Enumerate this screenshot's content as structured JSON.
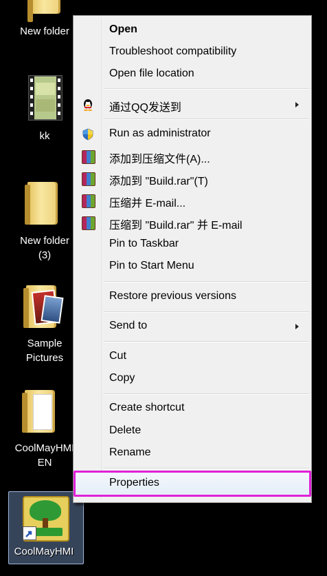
{
  "desktop": {
    "icons": [
      {
        "label": "New folder",
        "icon": "folder-icon"
      },
      {
        "label": "kk",
        "icon": "video-file-icon"
      },
      {
        "label": "New folder\n(3)",
        "icon": "folder-icon"
      },
      {
        "label": "Sample\nPictures",
        "icon": "pictures-folder-icon"
      },
      {
        "label": "CoolMayHMI\nEN",
        "icon": "folder-icon"
      },
      {
        "label": "CoolMayHMI",
        "icon": "app-shortcut-icon"
      }
    ]
  },
  "context_menu": {
    "items": [
      {
        "label": "Open"
      },
      {
        "label": "Troubleshoot compatibility"
      },
      {
        "label": "Open file location"
      },
      {
        "label": "通过QQ发送到",
        "icon": "qq-penguin-icon"
      },
      {
        "label": "Run as administrator",
        "icon": "uac-shield-icon"
      },
      {
        "label": "添加到压缩文件(A)...",
        "icon": "winrar-icon"
      },
      {
        "label": "添加到 \"Build.rar\"(T)",
        "icon": "winrar-icon"
      },
      {
        "label": "压缩并 E-mail...",
        "icon": "winrar-icon"
      },
      {
        "label": "压缩到 \"Build.rar\" 并 E-mail",
        "icon": "winrar-icon"
      },
      {
        "label": "Pin to Taskbar"
      },
      {
        "label": "Pin to Start Menu"
      },
      {
        "label": "Restore previous versions"
      },
      {
        "label": "Send to"
      },
      {
        "label": "Cut"
      },
      {
        "label": "Copy"
      },
      {
        "label": "Create shortcut"
      },
      {
        "label": "Delete"
      },
      {
        "label": "Rename"
      },
      {
        "label": "Properties"
      }
    ],
    "highlighted": "Properties",
    "highlight_color": "#e020d8"
  }
}
